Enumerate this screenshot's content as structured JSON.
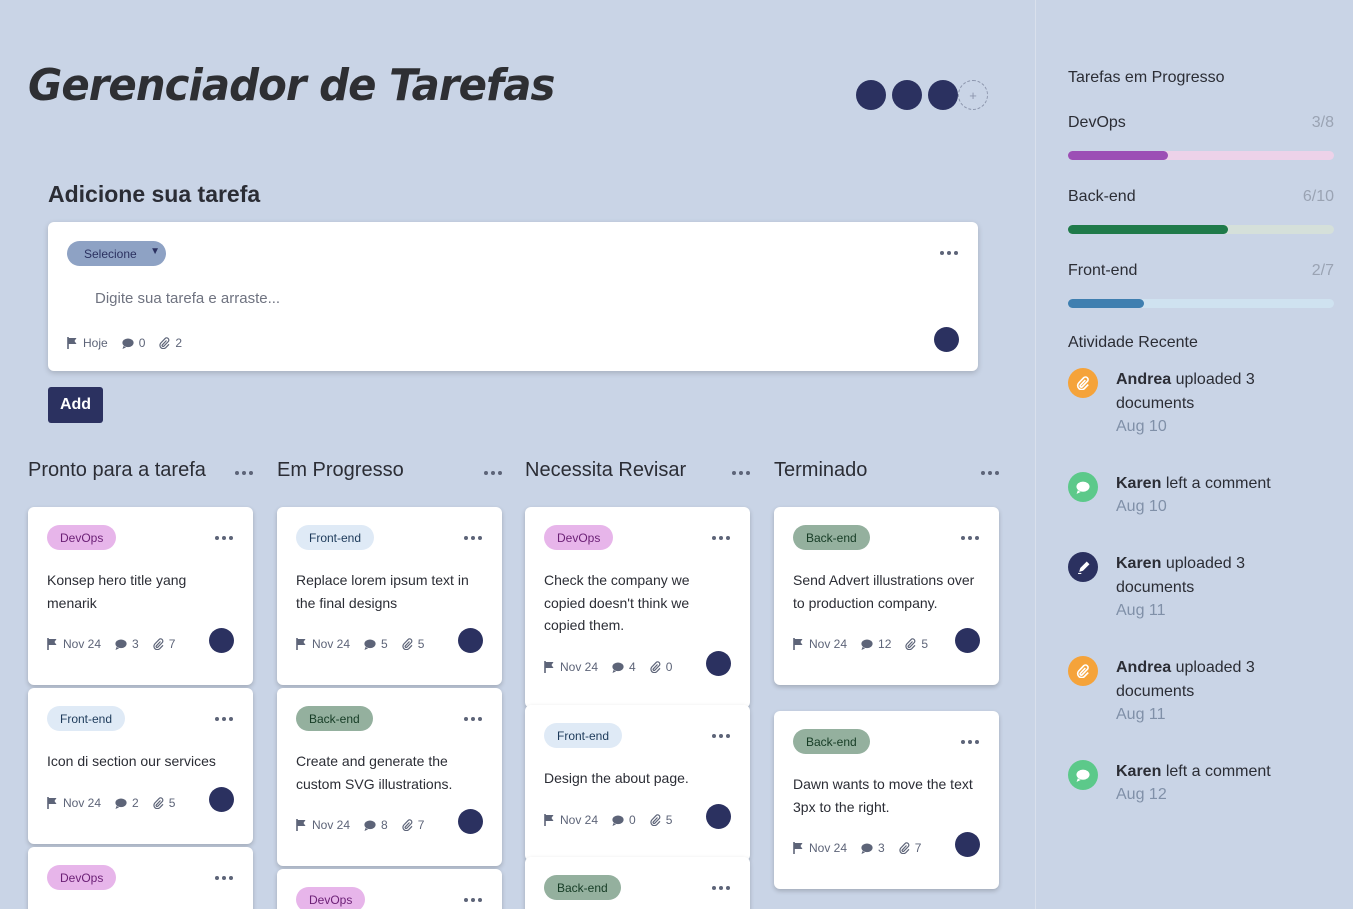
{
  "app_title": "Gerenciador de Tarefas",
  "add_avatar_label": "+",
  "add_section": {
    "title": "Adicione sua tarefa",
    "select_value": "Selecione",
    "input_placeholder": "Digite sua tarefa e arraste...",
    "date": "Hoje",
    "comments": "0",
    "attachments": "2",
    "button_label": "Add"
  },
  "columns": [
    {
      "title": "Pronto para a tarefa",
      "cards": [
        {
          "tag": "DevOps",
          "text": "Konsep hero title yang menarik",
          "date": "Nov 24",
          "comments": "3",
          "attachments": "7"
        },
        {
          "tag": "Front-end",
          "text": "Icon di section our services",
          "date": "Nov 24",
          "comments": "2",
          "attachments": "5"
        },
        {
          "tag": "DevOps"
        }
      ]
    },
    {
      "title": "Em Progresso",
      "cards": [
        {
          "tag": "Front-end",
          "text": "Replace lorem ipsum text in the final designs",
          "date": "Nov 24",
          "comments": "5",
          "attachments": "5"
        },
        {
          "tag": "Back-end",
          "text": "Create and generate the custom SVG illustrations.",
          "date": "Nov 24",
          "comments": "8",
          "attachments": "7"
        },
        {
          "tag": "DevOps"
        }
      ]
    },
    {
      "title": "Necessita Revisar",
      "cards": [
        {
          "tag": "DevOps",
          "text": "Check the company we copied doesn't think we copied them.",
          "date": "Nov 24",
          "comments": "4",
          "attachments": "0"
        },
        {
          "tag": "Front-end",
          "text": "Design the about page.",
          "date": "Nov 24",
          "comments": "0",
          "attachments": "5"
        },
        {
          "tag": "Back-end"
        }
      ]
    },
    {
      "title": "Terminado",
      "cards": [
        {
          "tag": "Back-end",
          "text": "Send Advert illustrations over to production company.",
          "date": "Nov 24",
          "comments": "12",
          "attachments": "5"
        },
        {
          "tag": "Back-end",
          "text": "Dawn wants to move the text 3px to the right.",
          "date": "Nov 24",
          "comments": "3",
          "attachments": "7"
        }
      ]
    }
  ],
  "sidebar": {
    "progress_title": "Tarefas em Progresso",
    "progress": [
      {
        "label": "DevOps",
        "count": "3/8",
        "fraction": 0.375,
        "color": "#9c4fb5",
        "track": "#edd2e9"
      },
      {
        "label": "Back-end",
        "count": "6/10",
        "fraction": 0.6,
        "color": "#1f7a4a",
        "track": "#d5e0da"
      },
      {
        "label": "Front-end",
        "count": "2/7",
        "fraction": 0.286,
        "color": "#3f7fb0",
        "track": "#cfe2f0"
      }
    ],
    "activity_title": "Atividade Recente",
    "activity": [
      {
        "user": "Andrea",
        "action": "uploaded 3 documents",
        "date": "Aug 10",
        "icon": "paperclip-icon",
        "color": "#f5a33a"
      },
      {
        "user": "Karen",
        "action": "left a comment",
        "date": "Aug 10",
        "icon": "comment-icon",
        "color": "#5cc98a"
      },
      {
        "user": "Karen",
        "action": "uploaded 3 documents",
        "date": "Aug 11",
        "icon": "pencil-icon",
        "color": "#2b3160"
      },
      {
        "user": "Andrea",
        "action": "uploaded 3 documents",
        "date": "Aug 11",
        "icon": "paperclip-icon",
        "color": "#f5a33a"
      },
      {
        "user": "Karen",
        "action": "left a comment",
        "date": "Aug 12",
        "icon": "comment-icon",
        "color": "#5cc98a"
      }
    ]
  }
}
